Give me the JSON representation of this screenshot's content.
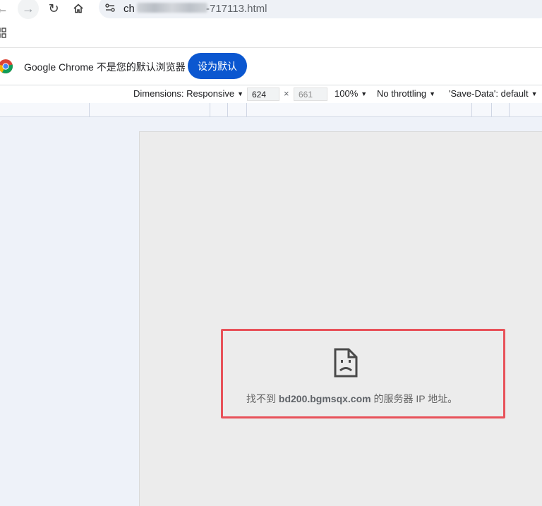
{
  "browser": {
    "url_prefix": "ch",
    "url_suffix": "-717113.html"
  },
  "infobar": {
    "message": "Google Chrome 不是您的默认浏览器",
    "set_default_label": "设为默认"
  },
  "devtools": {
    "dimensions_label": "Dimensions: Responsive",
    "width": "624",
    "times": "×",
    "height": "661",
    "zoom": "100%",
    "throttling": "No throttling",
    "save_data": "'Save-Data': default"
  },
  "error": {
    "prefix": "找不到",
    "host": "bd200.bgmsqx.com",
    "suffix": "的服务器 IP 地址。"
  },
  "colors": {
    "highlight": "#e8525a",
    "primary": "#0b57d0"
  }
}
